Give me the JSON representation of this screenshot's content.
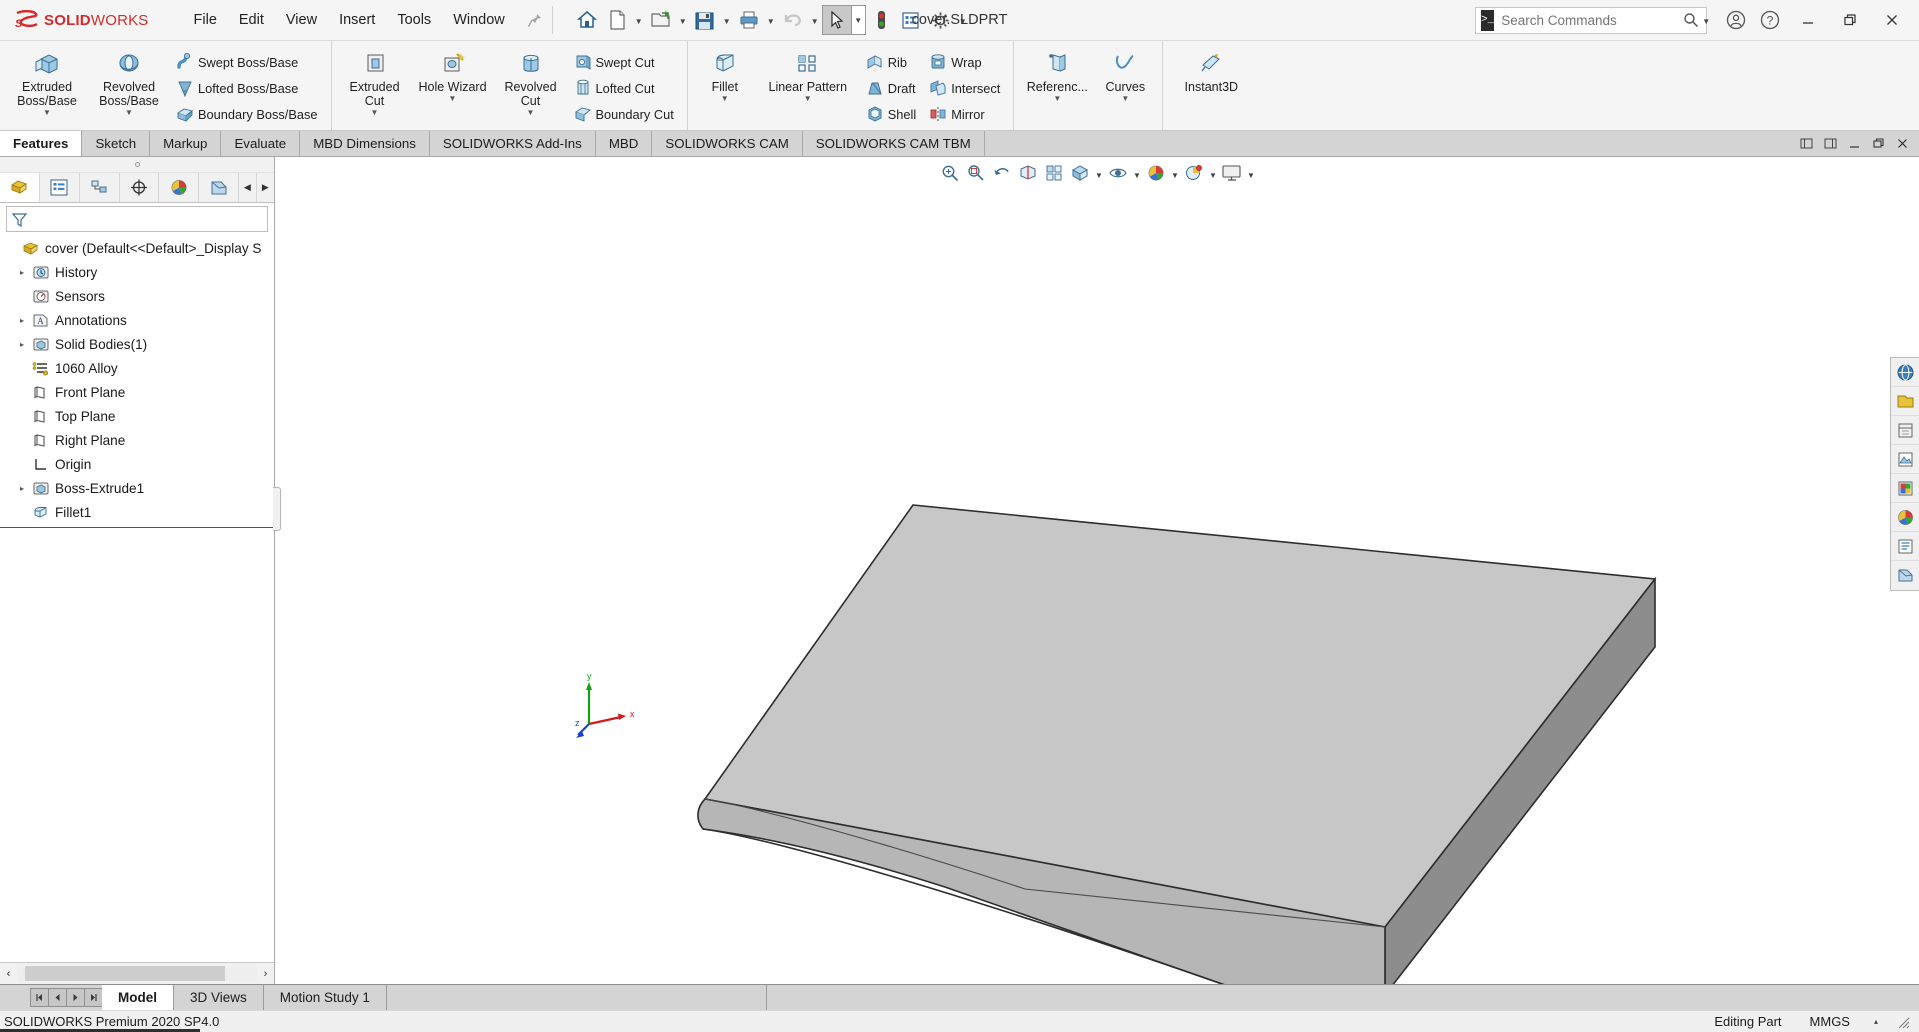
{
  "app": {
    "brand_ds": "3DS",
    "brand_solid": "SOLID",
    "brand_works": "WORKS",
    "document_title": "cover.SLDPRT"
  },
  "menubar": {
    "items": [
      {
        "label": "File",
        "name": "menu-file"
      },
      {
        "label": "Edit",
        "name": "menu-edit"
      },
      {
        "label": "View",
        "name": "menu-view"
      },
      {
        "label": "Insert",
        "name": "menu-insert"
      },
      {
        "label": "Tools",
        "name": "menu-tools"
      },
      {
        "label": "Window",
        "name": "menu-window"
      }
    ],
    "pin_icon": "pin-icon"
  },
  "quick_toolbar": {
    "items": [
      {
        "name": "home-icon",
        "title": "Home"
      },
      {
        "name": "new-document-icon",
        "title": "New"
      },
      {
        "name": "open-folder-icon",
        "title": "Open"
      },
      {
        "name": "save-icon",
        "title": "Save"
      },
      {
        "name": "print-icon",
        "title": "Print"
      },
      {
        "name": "undo-icon",
        "title": "Undo"
      },
      {
        "name": "select-cursor-icon",
        "title": "Select"
      },
      {
        "name": "rebuild-icon",
        "title": "Rebuild"
      },
      {
        "name": "file-properties-icon",
        "title": "File Properties"
      },
      {
        "name": "options-gear-icon",
        "title": "Options"
      }
    ]
  },
  "search": {
    "placeholder": "Search Commands",
    "value": ""
  },
  "window_controls": {
    "account": "user-account-icon",
    "help": "help-icon",
    "minimize": "minimize-icon",
    "restore": "restore-icon",
    "close": "close-icon"
  },
  "ribbon": {
    "groups": [
      {
        "name": "boss-base-group",
        "big": [
          {
            "label": "Extruded\nBoss/Base",
            "name": "extruded-boss-base-button",
            "icon": "extruded-boss-icon",
            "caret": true
          },
          {
            "label": "Revolved\nBoss/Base",
            "name": "revolved-boss-base-button",
            "icon": "revolved-boss-icon",
            "caret": true
          }
        ],
        "small": [
          {
            "label": "Swept Boss/Base",
            "name": "swept-boss-base-button",
            "icon": "swept-boss-icon"
          },
          {
            "label": "Lofted Boss/Base",
            "name": "lofted-boss-base-button",
            "icon": "lofted-boss-icon"
          },
          {
            "label": "Boundary Boss/Base",
            "name": "boundary-boss-base-button",
            "icon": "boundary-boss-icon"
          }
        ]
      },
      {
        "name": "cut-group",
        "big": [
          {
            "label": "Extruded\nCut",
            "name": "extruded-cut-button",
            "icon": "extruded-cut-icon",
            "caret": true
          },
          {
            "label": "Hole Wizard",
            "name": "hole-wizard-button",
            "icon": "hole-wizard-icon",
            "caret": true
          },
          {
            "label": "Revolved\nCut",
            "name": "revolved-cut-button",
            "icon": "revolved-cut-icon",
            "caret": false
          }
        ],
        "small": [
          {
            "label": "Swept Cut",
            "name": "swept-cut-button",
            "icon": "swept-cut-icon"
          },
          {
            "label": "Lofted Cut",
            "name": "lofted-cut-button",
            "icon": "lofted-cut-icon"
          },
          {
            "label": "Boundary Cut",
            "name": "boundary-cut-button",
            "icon": "boundary-cut-icon"
          }
        ]
      },
      {
        "name": "feature-group",
        "big": [
          {
            "label": "Fillet",
            "name": "fillet-button",
            "icon": "fillet-icon",
            "caret": true
          },
          {
            "label": "Linear Pattern",
            "name": "linear-pattern-button",
            "icon": "linear-pattern-icon",
            "caret": true
          }
        ],
        "small": [
          {
            "label": "Rib",
            "name": "rib-button",
            "icon": "rib-icon"
          },
          {
            "label": "Draft",
            "name": "draft-button",
            "icon": "draft-icon"
          },
          {
            "label": "Shell",
            "name": "shell-button",
            "icon": "shell-icon"
          }
        ],
        "small2": [
          {
            "label": "Wrap",
            "name": "wrap-button",
            "icon": "wrap-icon"
          },
          {
            "label": "Intersect",
            "name": "intersect-button",
            "icon": "intersect-icon"
          },
          {
            "label": "Mirror",
            "name": "mirror-button",
            "icon": "mirror-icon"
          }
        ]
      },
      {
        "name": "reference-group",
        "big": [
          {
            "label": "Referenc...",
            "name": "reference-geometry-button",
            "icon": "reference-geometry-icon",
            "caret": true
          },
          {
            "label": "Curves",
            "name": "curves-button",
            "icon": "curves-icon",
            "caret": true
          }
        ],
        "small": []
      },
      {
        "name": "instant3d-group",
        "big": [
          {
            "label": "Instant3D",
            "name": "instant3d-button",
            "icon": "instant3d-icon",
            "caret": false
          }
        ],
        "small": []
      }
    ]
  },
  "command_tabs": {
    "active": "Features",
    "items": [
      {
        "label": "Features",
        "name": "tab-features"
      },
      {
        "label": "Sketch",
        "name": "tab-sketch"
      },
      {
        "label": "Markup",
        "name": "tab-markup"
      },
      {
        "label": "Evaluate",
        "name": "tab-evaluate"
      },
      {
        "label": "MBD Dimensions",
        "name": "tab-mbd-dimensions"
      },
      {
        "label": "SOLIDWORKS Add-Ins",
        "name": "tab-solidworks-add-ins"
      },
      {
        "label": "MBD",
        "name": "tab-mbd"
      },
      {
        "label": "SOLIDWORKS CAM",
        "name": "tab-solidworks-cam"
      },
      {
        "label": "SOLIDWORKS CAM TBM",
        "name": "tab-solidworks-cam-tbm"
      }
    ]
  },
  "feature_manager": {
    "tabs": [
      {
        "name": "fm-tab-feature-manager-design-tree",
        "icon": "feature-tree-icon",
        "active": true
      },
      {
        "name": "fm-tab-property-manager",
        "icon": "property-manager-icon",
        "active": false
      },
      {
        "name": "fm-tab-configuration-manager",
        "icon": "configuration-manager-icon",
        "active": false
      },
      {
        "name": "fm-tab-dimxpert-manager",
        "icon": "dimxpert-icon",
        "active": false
      },
      {
        "name": "fm-tab-display-manager",
        "icon": "display-manager-icon",
        "active": false
      },
      {
        "name": "fm-tab-cam-feature-tree",
        "icon": "cam-tree-icon",
        "active": false
      }
    ],
    "filter_placeholder": "",
    "filter_value": "",
    "tree": [
      {
        "label": "cover  (Default<<Default>_Display S",
        "name": "tree-item-cover",
        "icon": "part-icon",
        "expand": "",
        "indent": 0
      },
      {
        "label": "History",
        "name": "tree-item-history",
        "icon": "history-icon",
        "expand": "▸",
        "indent": 1
      },
      {
        "label": "Sensors",
        "name": "tree-item-sensors",
        "icon": "sensors-icon",
        "expand": "",
        "indent": 1
      },
      {
        "label": "Annotations",
        "name": "tree-item-annotations",
        "icon": "annotations-icon",
        "expand": "▸",
        "indent": 1
      },
      {
        "label": "Solid Bodies(1)",
        "name": "tree-item-solid-bodies",
        "icon": "solid-bodies-icon",
        "expand": "▸",
        "indent": 1
      },
      {
        "label": "1060 Alloy",
        "name": "tree-item-material",
        "icon": "material-icon",
        "expand": "",
        "indent": 1
      },
      {
        "label": "Front Plane",
        "name": "tree-item-front-plane",
        "icon": "plane-icon",
        "expand": "",
        "indent": 1
      },
      {
        "label": "Top Plane",
        "name": "tree-item-top-plane",
        "icon": "plane-icon",
        "expand": "",
        "indent": 1
      },
      {
        "label": "Right Plane",
        "name": "tree-item-right-plane",
        "icon": "plane-icon",
        "expand": "",
        "indent": 1
      },
      {
        "label": "Origin",
        "name": "tree-item-origin",
        "icon": "origin-icon",
        "expand": "",
        "indent": 1
      },
      {
        "label": "Boss-Extrude1",
        "name": "tree-item-boss-extrude1",
        "icon": "boss-extrude-icon",
        "expand": "▸",
        "indent": 1
      },
      {
        "label": "Fillet1",
        "name": "tree-item-fillet1",
        "icon": "fillet-feature-icon",
        "expand": "",
        "indent": 1
      }
    ]
  },
  "view_toolbar": {
    "items": [
      {
        "name": "zoom-to-fit-icon",
        "caret": false
      },
      {
        "name": "zoom-to-area-icon",
        "caret": false
      },
      {
        "name": "previous-view-icon",
        "caret": false
      },
      {
        "name": "section-view-icon",
        "caret": false
      },
      {
        "name": "view-orientation-icon",
        "caret": false
      },
      {
        "name": "display-style-icon",
        "caret": true
      },
      {
        "name": "hide-show-items-icon",
        "caret": true
      },
      {
        "name": "edit-appearance-icon",
        "caret": true
      },
      {
        "name": "apply-scene-icon",
        "caret": true
      },
      {
        "name": "view-settings-icon",
        "caret": true
      }
    ]
  },
  "triad": {
    "x_label": "x",
    "y_label": "y",
    "z_label": "z",
    "x_color": "#d21b1b",
    "y_color": "#14a014",
    "z_color": "#1b3fd2"
  },
  "task_pane": {
    "items": [
      {
        "name": "solidworks-resources-icon"
      },
      {
        "name": "design-library-icon"
      },
      {
        "name": "file-explorer-icon"
      },
      {
        "name": "view-palette-icon"
      },
      {
        "name": "appearances-scenes-icon"
      },
      {
        "name": "custom-properties-icon"
      },
      {
        "name": "solidworks-forum-icon"
      },
      {
        "name": "solidworks-cam-pane-icon"
      }
    ]
  },
  "doc_tabs": {
    "active": "Model",
    "nav_buttons": [
      "⏮",
      "◀",
      "▶",
      "⏭"
    ],
    "items": [
      {
        "label": "Model",
        "name": "doc-tab-model"
      },
      {
        "label": "3D Views",
        "name": "doc-tab-3d-views"
      },
      {
        "label": "Motion Study 1",
        "name": "doc-tab-motion-study-1"
      }
    ]
  },
  "statusbar": {
    "version": "SOLIDWORKS Premium 2020 SP4.0",
    "editing": "Editing Part",
    "units": "MMGS",
    "caret": "▴",
    "resize_icon": "resize-grip-icon"
  },
  "colors": {
    "accent_red": "#d32b2b",
    "chrome": "#f5f5f5",
    "tab_bar": "#d4d4d4",
    "tree_select": "#1d5fa8",
    "model_top_face": "#c7c7c7",
    "model_side_face": "#9a9a9a",
    "model_front_face": "#bdbdbd"
  }
}
